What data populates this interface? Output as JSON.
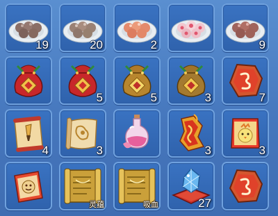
{
  "inventory": {
    "slots": [
      {
        "item": "brown-dumplings-icon",
        "count": "19"
      },
      {
        "item": "white-dumplings-icon",
        "count": "20"
      },
      {
        "item": "pink-dumplings-icon",
        "count": "2"
      },
      {
        "item": "flower-dumplings-icon",
        "count": ""
      },
      {
        "item": "red-dumplings-icon",
        "count": "9"
      },
      {
        "item": "red-lucky-bag-icon",
        "count": ""
      },
      {
        "item": "red-lucky-bag-icon",
        "count": "5"
      },
      {
        "item": "gold-lucky-bag-icon",
        "count": "5"
      },
      {
        "item": "gold-lucky-bag-icon",
        "count": "3"
      },
      {
        "item": "red-rune-stone-icon",
        "count": "7"
      },
      {
        "item": "brush-scroll-icon",
        "count": "4"
      },
      {
        "item": "map-scroll-icon",
        "count": "3"
      },
      {
        "item": "potion-bottle-icon",
        "count": ""
      },
      {
        "item": "flame-talisman-icon",
        "count": "3"
      },
      {
        "item": "chick-scroll-icon",
        "count": "3"
      },
      {
        "item": "face-scroll-icon",
        "count": ""
      },
      {
        "item": "golden-scroll-icon",
        "count": "",
        "label": "灵蕴"
      },
      {
        "item": "golden-scroll-icon",
        "count": "",
        "label": "吸血"
      },
      {
        "item": "crystal-cushion-icon",
        "count": "27"
      },
      {
        "item": "red-rune-stone-icon",
        "count": ""
      }
    ]
  },
  "colors": {
    "background": "#4a7fc3",
    "slot_fill": "#3a73c2",
    "slot_border": "#6fa1de"
  }
}
